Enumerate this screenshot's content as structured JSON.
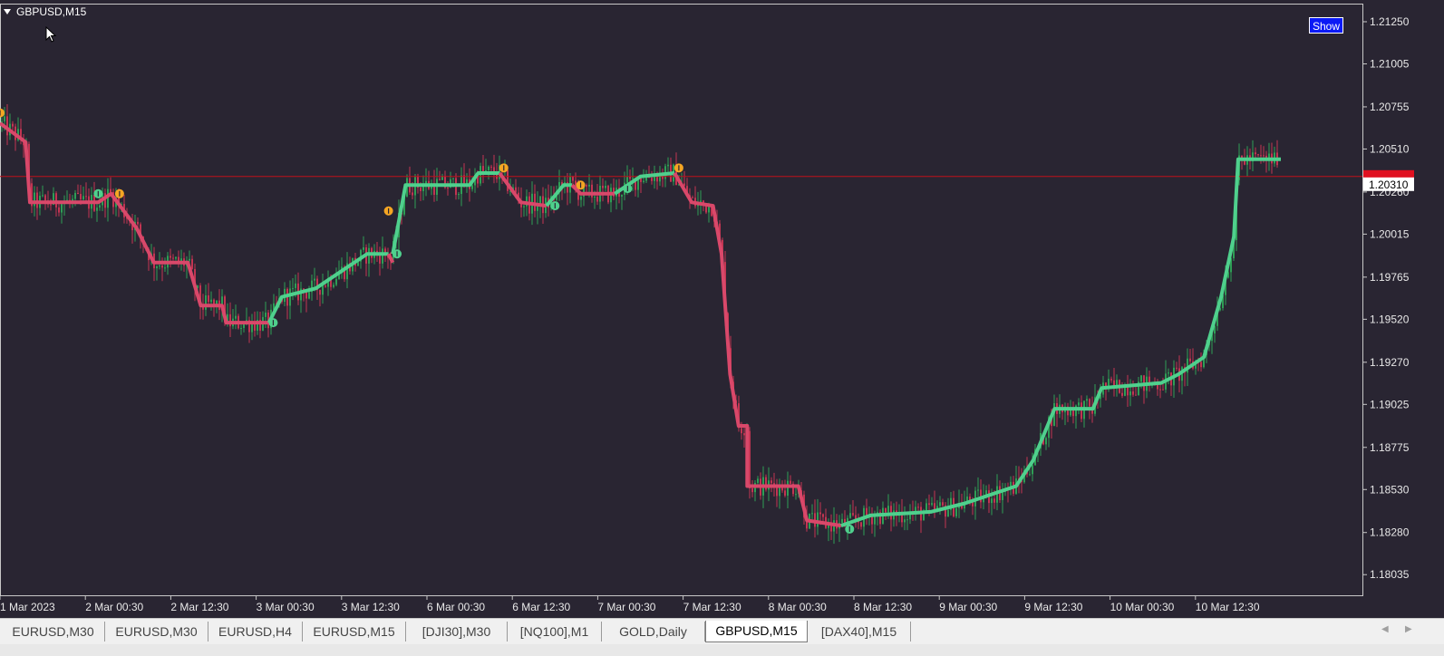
{
  "window": {
    "title": "GBPUSD,M15",
    "show_button": "Show"
  },
  "colors": {
    "background": "#292532",
    "bull_candle": "#2e9e55",
    "bear_candle": "#c23552",
    "trend_up": "#4fd08d",
    "trend_down": "#d9486a",
    "price_line": "#c0101a",
    "signal_marker": "#f5a623"
  },
  "price_axis": {
    "labels": [
      "1.21250",
      "1.21005",
      "1.20755",
      "1.20510",
      "1.20260",
      "1.20015",
      "1.19765",
      "1.19520",
      "1.19270",
      "1.19025",
      "1.18775",
      "1.18530",
      "1.18280",
      "1.18035"
    ],
    "current_price": "1.20310",
    "marker_hidden_value": "1.20350"
  },
  "time_axis": {
    "labels": [
      "1 Mar 2023",
      "2 Mar 00:30",
      "2 Mar 12:30",
      "3 Mar 00:30",
      "3 Mar 12:30",
      "6 Mar 00:30",
      "6 Mar 12:30",
      "7 Mar 00:30",
      "7 Mar 12:30",
      "8 Mar 00:30",
      "8 Mar 12:30",
      "9 Mar 00:30",
      "9 Mar 12:30",
      "10 Mar 00:30",
      "10 Mar 12:30"
    ]
  },
  "chart_data": {
    "type": "line",
    "symbol": "GBPUSD",
    "timeframe": "M15",
    "y_range": [
      1.1795,
      1.213
    ],
    "x_labels": [
      "1 Mar 2023",
      "2 Mar 00:30",
      "2 Mar 12:30",
      "3 Mar 00:30",
      "3 Mar 12:30",
      "6 Mar 00:30",
      "6 Mar 12:30",
      "7 Mar 00:30",
      "7 Mar 12:30",
      "8 Mar 00:30",
      "8 Mar 12:30",
      "9 Mar 00:30",
      "9 Mar 12:30",
      "10 Mar 00:30",
      "10 Mar 12:30"
    ],
    "series": [
      {
        "trend_segments": [
          {
            "dir": "down",
            "points": [
              [
                0,
                1.2066
              ],
              [
                0.3,
                1.2055
              ],
              [
                0.35,
                1.202
              ],
              [
                1.15,
                1.202
              ],
              [
                1.3,
                1.2025
              ],
              [
                1.6,
                1.2005
              ],
              [
                1.8,
                1.1985
              ],
              [
                2.2,
                1.1985
              ],
              [
                2.35,
                1.196
              ],
              [
                2.6,
                1.196
              ],
              [
                2.65,
                1.195
              ],
              [
                3.15,
                1.195
              ]
            ]
          },
          {
            "dir": "up",
            "points": [
              [
                3.15,
                1.195
              ],
              [
                3.3,
                1.1965
              ],
              [
                3.7,
                1.197
              ],
              [
                4.0,
                1.198
              ],
              [
                4.3,
                1.199
              ],
              [
                4.55,
                1.199
              ]
            ]
          },
          {
            "dir": "down",
            "points": [
              [
                4.55,
                1.199
              ],
              [
                4.6,
                1.1985
              ]
            ]
          },
          {
            "dir": "up",
            "points": [
              [
                4.6,
                1.199
              ],
              [
                4.75,
                1.203
              ],
              [
                5.5,
                1.203
              ],
              [
                5.6,
                1.2037
              ],
              [
                5.85,
                1.2037
              ]
            ]
          },
          {
            "dir": "down",
            "points": [
              [
                5.85,
                1.2037
              ],
              [
                6.1,
                1.202
              ],
              [
                6.4,
                1.2018
              ]
            ]
          },
          {
            "dir": "up",
            "points": [
              [
                6.4,
                1.2018
              ],
              [
                6.6,
                1.203
              ],
              [
                6.7,
                1.203
              ]
            ]
          },
          {
            "dir": "down",
            "points": [
              [
                6.7,
                1.203
              ],
              [
                6.8,
                1.2025
              ],
              [
                7.2,
                1.2025
              ]
            ]
          },
          {
            "dir": "up",
            "points": [
              [
                7.2,
                1.2025
              ],
              [
                7.5,
                1.2035
              ],
              [
                7.9,
                1.2037
              ]
            ]
          },
          {
            "dir": "down",
            "points": [
              [
                7.9,
                1.2037
              ],
              [
                8.1,
                1.202
              ],
              [
                8.35,
                1.2018
              ],
              [
                8.45,
                1.199
              ],
              [
                8.55,
                1.192
              ],
              [
                8.65,
                1.189
              ],
              [
                8.75,
                1.189
              ],
              [
                8.75,
                1.1855
              ],
              [
                9.35,
                1.1855
              ],
              [
                9.45,
                1.1835
              ],
              [
                9.85,
                1.1832
              ]
            ]
          },
          {
            "dir": "up",
            "points": [
              [
                9.85,
                1.1832
              ],
              [
                10.2,
                1.1838
              ],
              [
                10.9,
                1.184
              ],
              [
                11.3,
                1.1845
              ],
              [
                11.6,
                1.185
              ],
              [
                11.9,
                1.1855
              ],
              [
                12.1,
                1.187
              ],
              [
                12.35,
                1.19
              ],
              [
                12.8,
                1.19
              ],
              [
                12.9,
                1.1912
              ],
              [
                13.6,
                1.1915
              ],
              [
                13.8,
                1.192
              ],
              [
                14.1,
                1.193
              ],
              [
                14.3,
                1.1965
              ],
              [
                14.45,
                1.2
              ],
              [
                14.5,
                1.2045
              ],
              [
                15.0,
                1.2045
              ]
            ]
          }
        ]
      }
    ],
    "signals": [
      {
        "type": "sell",
        "x": 0.0,
        "y": 1.2072
      },
      {
        "type": "buy",
        "x": 1.15,
        "y": 1.2025
      },
      {
        "type": "sell",
        "x": 1.4,
        "y": 1.2025
      },
      {
        "type": "buy",
        "x": 3.2,
        "y": 1.195
      },
      {
        "type": "sell",
        "x": 4.55,
        "y": 1.2015
      },
      {
        "type": "buy",
        "x": 4.65,
        "y": 1.199
      },
      {
        "type": "sell",
        "x": 5.9,
        "y": 1.204
      },
      {
        "type": "buy",
        "x": 6.5,
        "y": 1.2018
      },
      {
        "type": "sell",
        "x": 6.8,
        "y": 1.203
      },
      {
        "type": "buy",
        "x": 7.35,
        "y": 1.2028
      },
      {
        "type": "sell",
        "x": 7.95,
        "y": 1.204
      },
      {
        "type": "buy",
        "x": 9.95,
        "y": 1.183
      }
    ],
    "price_line": 1.2035
  },
  "tabs": [
    {
      "label": "EURUSD,M30",
      "active": false
    },
    {
      "label": "EURUSD,M30",
      "active": false
    },
    {
      "label": "EURUSD,H4",
      "active": false
    },
    {
      "label": "EURUSD,M15",
      "active": false
    },
    {
      "label": "[DJI30],M30",
      "active": false
    },
    {
      "label": "[NQ100],M1",
      "active": false
    },
    {
      "label": "GOLD,Daily",
      "active": false
    },
    {
      "label": "GBPUSD,M15",
      "active": true
    },
    {
      "label": "[DAX40],M15",
      "active": false
    }
  ]
}
